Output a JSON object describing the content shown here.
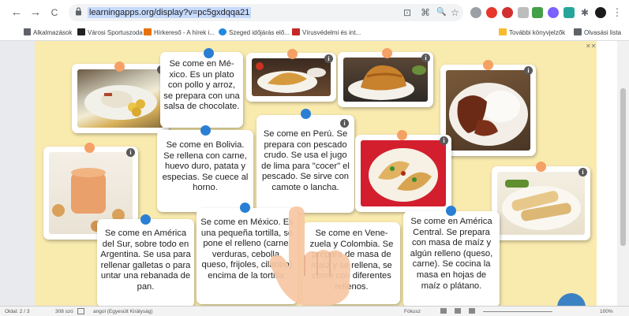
{
  "browser": {
    "url": "learningapps.org/display?v=pc5gxdqqa21",
    "nav": {
      "back": "←",
      "forward": "→",
      "reload": "C"
    },
    "omnibox_icons": [
      "⊡",
      "⌘",
      "🔍",
      "☆"
    ],
    "extension_icon_names": [
      "extension-1-icon",
      "opera-icon",
      "lastpass-icon",
      "extension-4-icon",
      "extension-5-icon",
      "extension-6-icon",
      "extension-7-icon",
      "pin-extension-icon",
      "profile-icon",
      "menu-icon"
    ]
  },
  "bookmarks": {
    "apps": "Alkalmazások",
    "items": [
      "Városi Sportuszoda",
      "Hírkereső - A hírek i...",
      "Szeged időjárás elő...",
      "Vírusvédelmi és int..."
    ],
    "more": "További könyvjelzők",
    "reading_list": "Olvasási lista"
  },
  "cards": {
    "t1": "Se come en Mé­xico. Es un plato con pollo y arroz, se prepara con una salsa de chocolate.",
    "t2": "Se come en Perú. Se prepara con pescado crudo. Se usa el jugo de lima para \"cocer\" el pescado. Se sirve con camote o lancha.",
    "t3": "Se come en Boli­via. Se rellena con carne, huevo duro, patata y especias. Se cu­ece al horno.",
    "t4": "Se come en Amé­rica del Sur, sobre todo en Argentina. Se usa para rel­lenar galletas o para untar una re­banada de pan.",
    "t5": "Se come en Mé­xico. Es una pequeña tortilla, se pone el relleno (carne, verduras, cebolla, queso, fri­joles, cilantro) en­cima de la tortilla.",
    "t6": "Se come en Vene­zuela y Colombia. Se prepara de masa de maíz y se rellena, se come con diferen­tes rellenos.",
    "t7": "Se come en Amé­rica Central. Se prepara con masa de maíz y algún relleno (queso, carne). Se cocina la masa en hojas de maíz o plátano.",
    "info_glyph": "i"
  },
  "statusbar": {
    "page": "Oldal: 2 / 3",
    "words": "308 szó",
    "language": "angol (Egyesült Királyság)",
    "focus": "Fókusz",
    "zoom": "100%"
  },
  "colors": {
    "background": "#f9eaae",
    "pin_orange": "#f5a166",
    "pin_blue": "#2a7fd4",
    "info_badge": "#595959"
  }
}
